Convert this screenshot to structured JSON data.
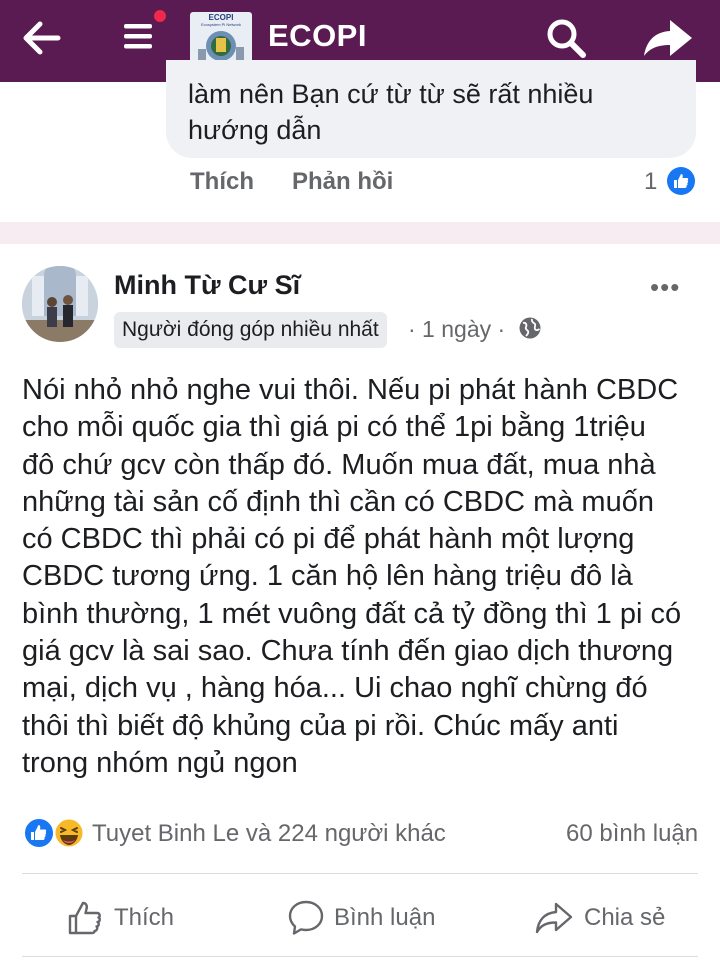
{
  "header": {
    "title": "ECOPI",
    "logo_text": "ECOPI",
    "logo_subtext": "Ecosystem Pi Network",
    "notification_dot_color": "#f0284a",
    "bar_color": "#5a1a52",
    "icons": [
      "back-arrow-icon",
      "menu-icon",
      "search-icon",
      "share-arrow-icon"
    ]
  },
  "previous_comment": {
    "text_lines": [
      "làm nên Bạn cứ từ từ sẽ rất nhiều",
      "hướng dẫn"
    ],
    "like_label": "Thích",
    "reply_label": "Phản hồi",
    "reaction_count": "1"
  },
  "post": {
    "author": "Minh Từ Cư Sĩ",
    "badge": "Người đóng góp nhiều nhất",
    "time": "· 1 ngày ·",
    "more_label": "•••",
    "body_lines": [
      "Nói nhỏ nhỏ nghe vui thôi. Nếu pi phát hành CBDC",
      "cho mỗi quốc gia thì giá pi có thể 1pi bằng 1triệu",
      "đô chứ gcv còn thấp đó. Muốn mua đất, mua nhà",
      "những tài sản cố định thì cần  có CBDC mà muốn",
      "có CBDC thì phải có pi để phát hành một lượng",
      "CBDC tương ứng. 1 căn hộ lên hàng triệu đô là",
      "bình thường, 1 mét vuông đất cả tỷ đồng thì 1 pi có",
      "giá gcv là sai sao. Chưa tính đến giao dịch thương",
      "mại, dịch vụ , hàng hóa... Ui chao nghĩ chừng đó",
      "thôi thì biết độ khủng của pi rồi. Chúc mấy anti",
      "trong nhóm ngủ ngon"
    ],
    "reactions_text": "Tuyet Binh Le và 224 người khác",
    "comments_count": "60 bình luận",
    "actions": {
      "like": "Thích",
      "comment": "Bình luận",
      "share": "Chia sẻ"
    }
  },
  "colors": {
    "facebook_blue": "#1877f2",
    "secondary_text": "#65676b"
  }
}
